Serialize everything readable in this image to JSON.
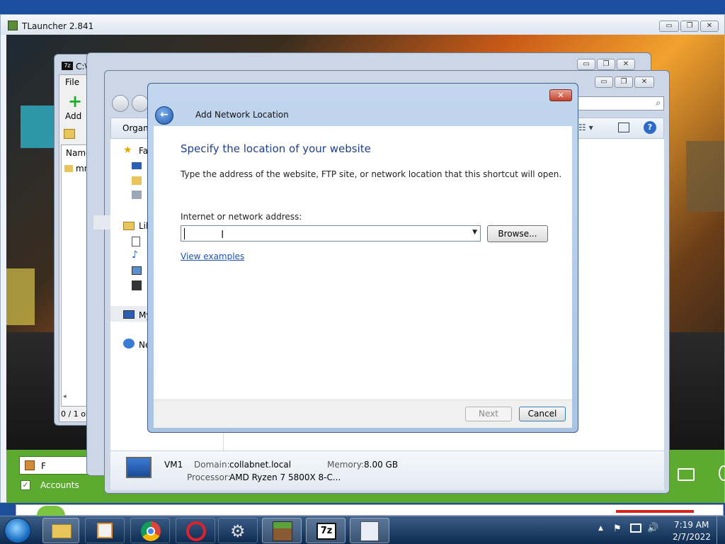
{
  "tlauncher": {
    "title": "TLauncher 2.841",
    "min": "▭",
    "max": "❐",
    "close": "✕",
    "player_name": "F",
    "accounts_label": "Accounts"
  },
  "zip_window": {
    "title": "C:\\",
    "menu_file": "File",
    "add_label": "Add",
    "col_name": "Name",
    "row_name": "mr",
    "status": "0 / 1 ob"
  },
  "explorer": {
    "toolbar_label": "Organi",
    "favorites": "Fa",
    "libraries": "Lib",
    "computer": "My",
    "network": "Ne",
    "details": {
      "name": "VM1",
      "domain_label": "Domain:",
      "domain_value": "collabnet.local",
      "memory_label": "Memory:",
      "memory_value": "8.00 GB",
      "processor_label": "Processor:",
      "processor_value": "AMD Ryzen 7 5800X 8-C..."
    }
  },
  "dialog": {
    "title": "Add Network Location",
    "heading": "Specify the location of your website",
    "description": "Type the address of the website, FTP site, or network location that this shortcut will open.",
    "field_label": "Internet or network address:",
    "field_value": "",
    "browse_label": "Browse...",
    "link_label": "View examples",
    "next_label": "Next",
    "cancel_label": "Cancel"
  },
  "taskbar": {
    "time": "7:19 AM",
    "date": "2/7/2022",
    "apps": [
      "Windows Explorer",
      "Media Player",
      "Google Chrome",
      "Opera",
      "Settings",
      "Minecraft",
      "7-Zip",
      "Control Panel"
    ]
  },
  "colors": {
    "heading_blue": "#1f3f88",
    "link_blue": "#1e54b0",
    "taskbar_dark": "#0d2a50",
    "tlauncher_green": "#5daa30"
  }
}
